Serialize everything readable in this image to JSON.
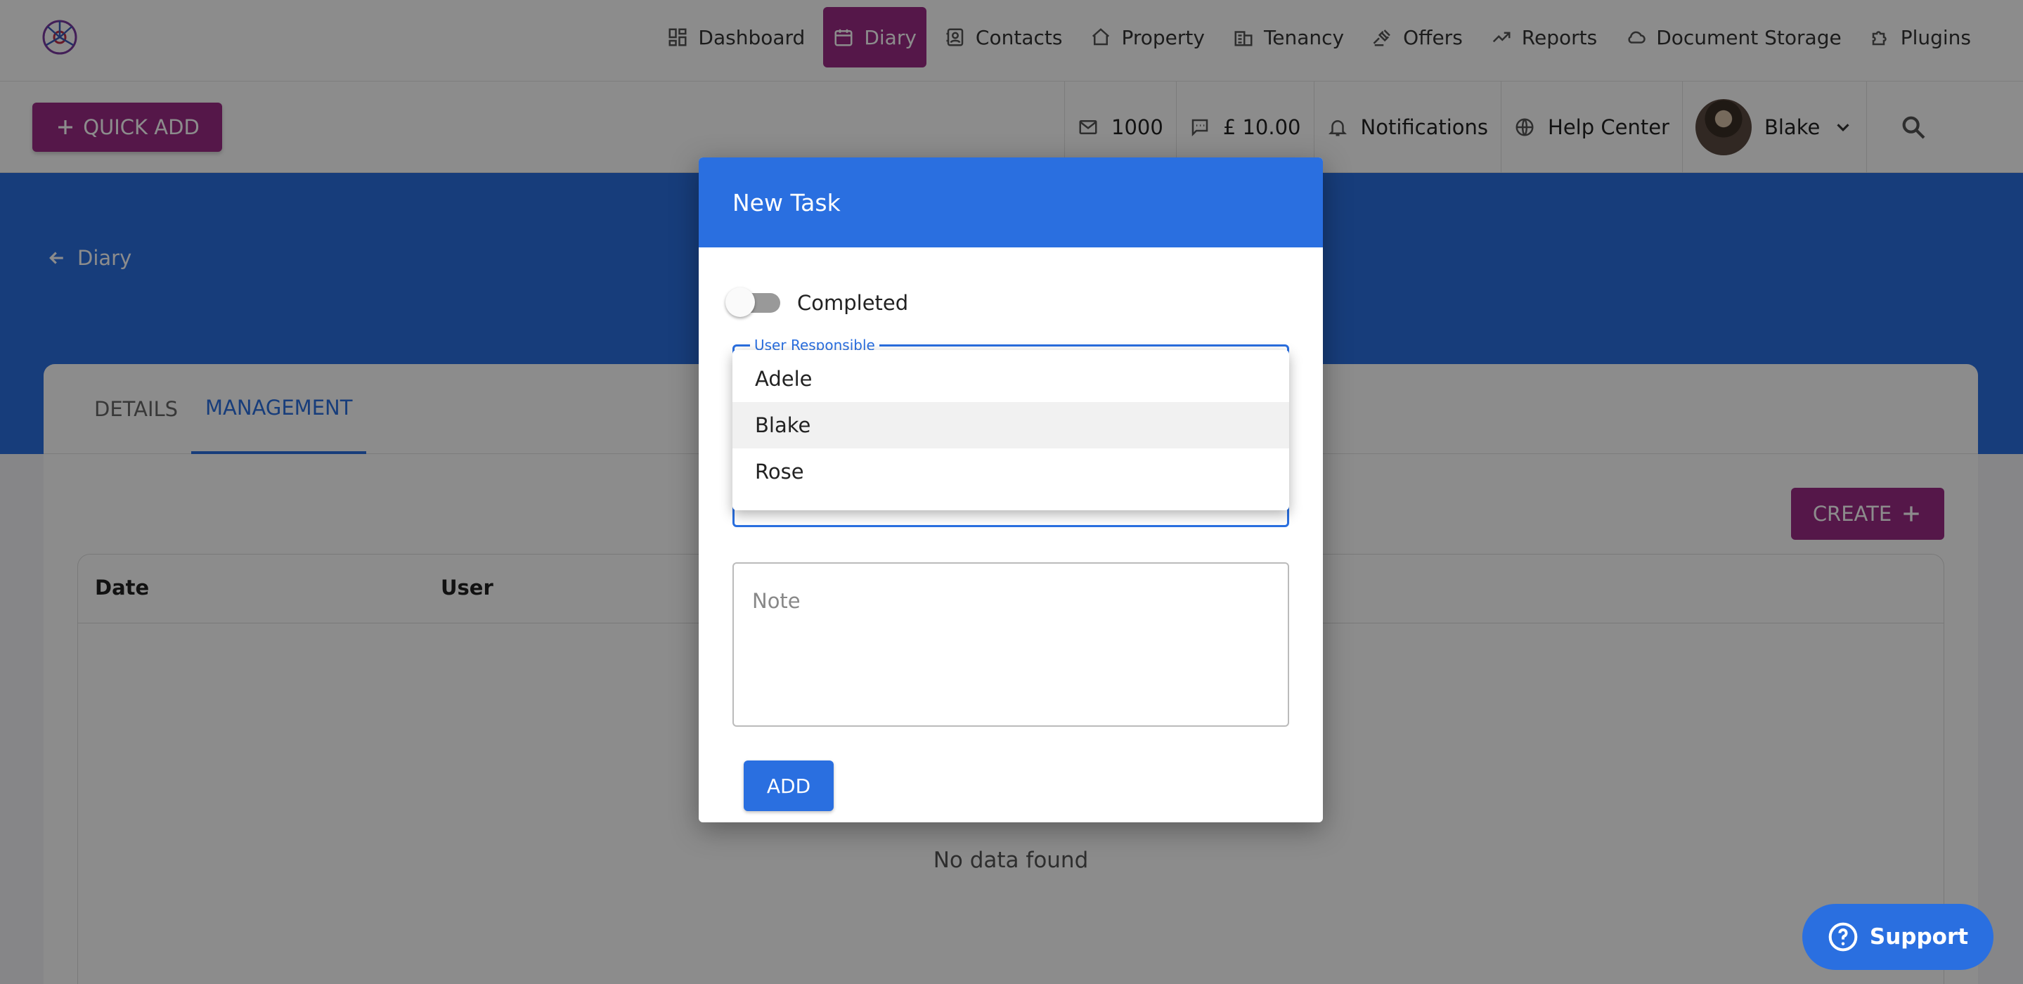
{
  "nav": {
    "items": [
      {
        "label": "Dashboard",
        "icon": "dashboard-icon"
      },
      {
        "label": "Diary",
        "icon": "calendar-icon",
        "active": true
      },
      {
        "label": "Contacts",
        "icon": "contacts-icon"
      },
      {
        "label": "Property",
        "icon": "home-icon"
      },
      {
        "label": "Tenancy",
        "icon": "building-icon"
      },
      {
        "label": "Offers",
        "icon": "gavel-icon"
      },
      {
        "label": "Reports",
        "icon": "trending-icon"
      },
      {
        "label": "Document Storage",
        "icon": "cloud-icon"
      },
      {
        "label": "Plugins",
        "icon": "puzzle-icon"
      }
    ]
  },
  "toolbar": {
    "quick_add": "QUICK ADD",
    "mail_count": "1000",
    "sms_credit": "£ 10.00",
    "notifications": "Notifications",
    "help": "Help Center",
    "user_name": "Blake"
  },
  "page": {
    "back_label": "Diary",
    "tabs": [
      {
        "label": "DETAILS"
      },
      {
        "label": "MANAGEMENT",
        "active": true
      }
    ],
    "create_label": "CREATE",
    "columns": [
      "Date",
      "User"
    ],
    "empty_text": "No data found"
  },
  "modal": {
    "title": "New Task",
    "completed_label": "Completed",
    "completed": false,
    "user_field_label": "User Responsible",
    "user_options": [
      "Adele",
      "Blake",
      "Rose"
    ],
    "highlighted_option": "Blake",
    "note_placeholder": "Note",
    "add_label": "ADD"
  },
  "support": {
    "label": "Support"
  },
  "colors": {
    "brand_purple": "#9b2a86",
    "primary_blue": "#2a6fe0"
  }
}
